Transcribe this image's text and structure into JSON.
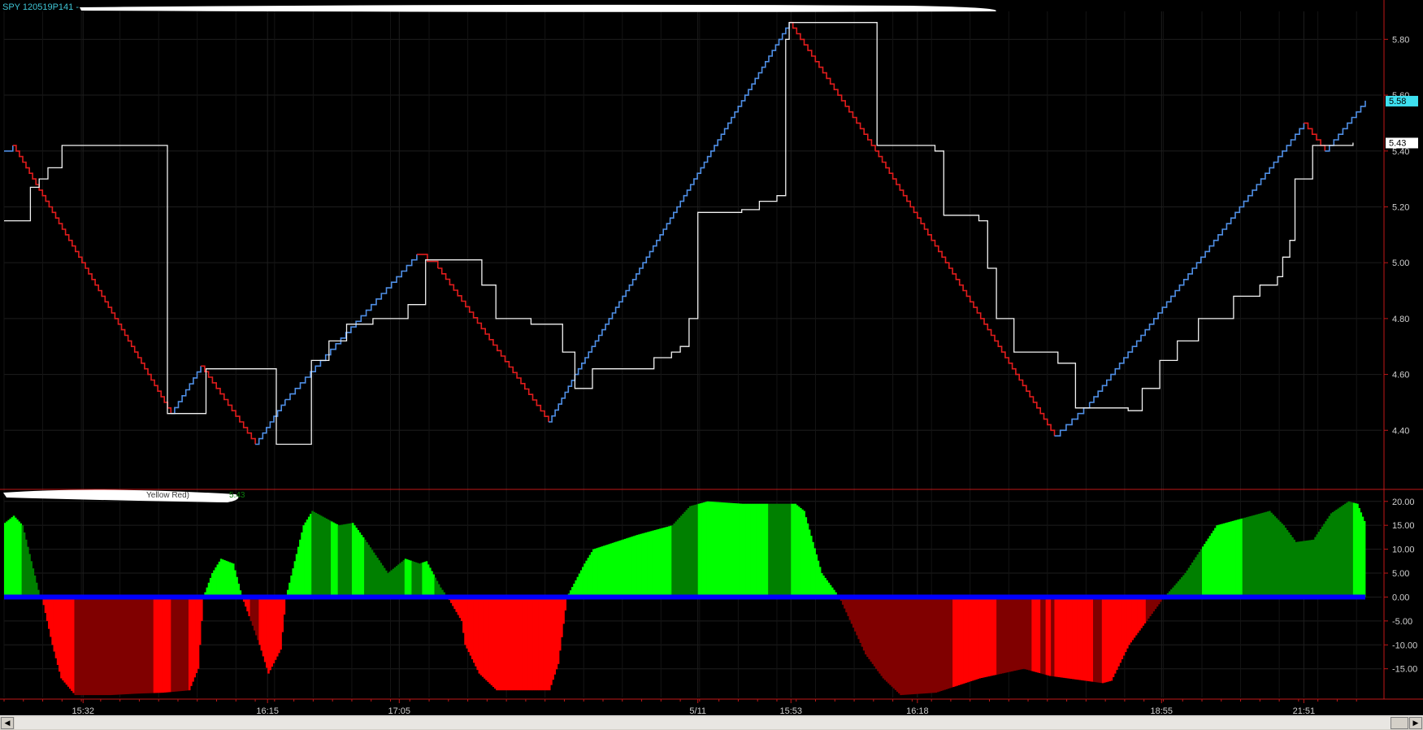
{
  "window": {
    "title": "SPY 120519P141 -",
    "indicator_label": "Yellow Red)",
    "indicator_value": "5.43"
  },
  "colors": {
    "background": "#000000",
    "grid": "#1e1e1e",
    "axis": "#c01818",
    "renko_up": "#4f8fe6",
    "renko_down": "#e21c1c",
    "price_line": "#f2f2f2",
    "hist_pos_bright": "#00ff00",
    "hist_pos_dark": "#008000",
    "hist_neg_bright": "#ff0000",
    "hist_neg_dark": "#800000",
    "zero_line": "#0000ff",
    "last_badge": "#3ee0f0",
    "price_badge": "#ffffff"
  },
  "chart_data": [
    {
      "type": "line",
      "title": "SPY 120519P141 -",
      "xlabel": "",
      "ylabel": "",
      "ylim": [
        4.2,
        5.9
      ],
      "yticks": [
        "5.80",
        "5.60",
        "5.40",
        "5.20",
        "5.00",
        "4.80",
        "4.60",
        "4.40"
      ],
      "ytick_values": [
        5.8,
        5.6,
        5.4,
        5.2,
        5.0,
        4.8,
        4.6,
        4.4
      ],
      "xticks": [
        "15:32",
        "16:15",
        "17:05",
        "5/11",
        "15:53",
        "16:18",
        "18:55",
        "21:51"
      ],
      "xtick_index": [
        45,
        150,
        225,
        395,
        448,
        520,
        659,
        740
      ],
      "n": 775,
      "last_values": {
        "renko": "5.58",
        "price": "5.43"
      },
      "series": [
        {
          "type": "renko-step",
          "x": [
            0,
            5,
            95,
            112,
            143,
            160,
            235,
            247,
            310,
            325,
            447,
            496,
            598,
            618,
            740,
            752,
            775
          ],
          "y": [
            5.4,
            5.42,
            4.46,
            4.63,
            4.35,
            4.51,
            5.03,
            4.98,
            4.43,
            4.6,
            5.86,
            5.4,
            4.38,
            4.5,
            5.5,
            5.4,
            5.58
          ]
        },
        {
          "type": "step",
          "x": [
            0,
            12,
            15,
            20,
            25,
            33,
            92,
            93,
            115,
            140,
            155,
            165,
            175,
            185,
            195,
            210,
            230,
            240,
            268,
            272,
            280,
            300,
            310,
            318,
            325,
            335,
            370,
            380,
            385,
            390,
            395,
            420,
            430,
            440,
            445,
            447,
            452,
            495,
            497,
            510,
            530,
            535,
            555,
            560,
            565,
            575,
            600,
            610,
            640,
            648,
            658,
            668,
            680,
            700,
            715,
            725,
            728,
            732,
            735,
            745,
            760,
            768
          ],
          "y": [
            5.15,
            5.15,
            5.27,
            5.3,
            5.34,
            5.42,
            5.42,
            4.46,
            4.62,
            4.62,
            4.35,
            4.35,
            4.65,
            4.72,
            4.78,
            4.8,
            4.85,
            5.01,
            5.01,
            4.92,
            4.8,
            4.78,
            4.78,
            4.68,
            4.55,
            4.62,
            4.66,
            4.68,
            4.7,
            4.8,
            5.18,
            5.19,
            5.22,
            5.24,
            5.8,
            5.86,
            5.86,
            5.86,
            5.42,
            5.42,
            5.4,
            5.17,
            5.15,
            4.98,
            4.8,
            4.68,
            4.64,
            4.48,
            4.47,
            4.55,
            4.65,
            4.72,
            4.8,
            4.88,
            4.92,
            4.95,
            5.02,
            5.08,
            5.3,
            5.42,
            5.42,
            5.43
          ]
        }
      ]
    },
    {
      "type": "bar",
      "title": "",
      "xlabel": "",
      "ylabel": "",
      "ylim": [
        -21,
        22
      ],
      "yticks": [
        "20.00",
        "15.00",
        "10.00",
        "5.00",
        "0.00",
        "-5.00",
        "-10.00",
        "-15.00"
      ],
      "ytick_values": [
        20,
        15,
        10,
        5,
        0,
        -5,
        -10,
        -15
      ],
      "n": 775,
      "shape": {
        "x": [
          0,
          5,
          10,
          20,
          21,
          27,
          32,
          40,
          45,
          60,
          75,
          90,
          105,
          110,
          113,
          118,
          123,
          130,
          135,
          145,
          150,
          157,
          160,
          170,
          175,
          190,
          198,
          205,
          218,
          228,
          236,
          240,
          248,
          252,
          260,
          262,
          270,
          280,
          290,
          310,
          315,
          320,
          330,
          335,
          360,
          380,
          390,
          400,
          420,
          430,
          440,
          450,
          455,
          465,
          475,
          490,
          500,
          510,
          530,
          555,
          580,
          595,
          605,
          615,
          625,
          630,
          640,
          650,
          660,
          665,
          672,
          690,
          720,
          728,
          735,
          745,
          755,
          765,
          770,
          775
        ],
        "y": [
          15.5,
          17,
          15,
          0,
          0,
          -10,
          -17,
          -20.5,
          -20.5,
          -20.5,
          -20.2,
          -20,
          -19.5,
          -15,
          0,
          5,
          8,
          7,
          0,
          -10,
          -16,
          -11,
          0,
          15,
          18,
          15,
          15.5,
          12,
          5,
          8,
          7,
          7.5,
          2,
          0,
          -5,
          -10,
          -16,
          -19.5,
          -19.5,
          -19.5,
          -14,
          0,
          7,
          10,
          13,
          15,
          19,
          20,
          19.5,
          19.5,
          19.5,
          19.5,
          18,
          5,
          0,
          -12,
          -17,
          -20.5,
          -20,
          -17,
          -15,
          -16.5,
          -17,
          -17.5,
          -18,
          -17.5,
          -10,
          -5,
          0,
          2,
          5,
          15,
          18,
          15,
          11.5,
          12,
          17.5,
          20,
          19.5,
          15,
          8,
          2,
          1,
          5
        ]
      },
      "dark_ranges": [
        [
          10,
          20
        ],
        [
          40,
          85
        ],
        [
          95,
          105
        ],
        [
          140,
          145
        ],
        [
          175,
          186
        ],
        [
          190,
          198
        ],
        [
          205,
          228
        ],
        [
          232,
          238
        ],
        [
          245,
          252
        ],
        [
          380,
          395
        ],
        [
          435,
          448
        ],
        [
          475,
          540
        ],
        [
          565,
          585
        ],
        [
          590,
          593
        ],
        [
          596,
          598
        ],
        [
          620,
          625
        ],
        [
          650,
          682
        ],
        [
          705,
          768
        ]
      ]
    }
  ]
}
